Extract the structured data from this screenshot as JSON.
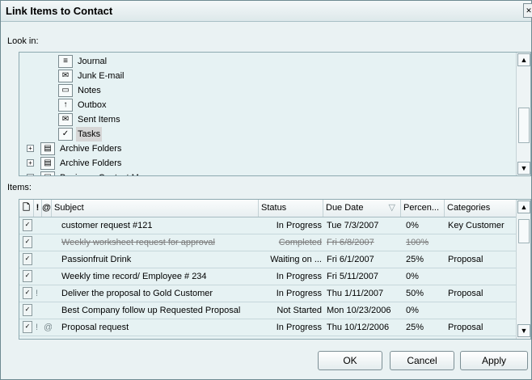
{
  "dialog": {
    "title": "Link Items to Contact"
  },
  "look_in_label": "Look in:",
  "items_label": "Items:",
  "folders": [
    {
      "label": "Journal",
      "icon": "journal-icon",
      "glyph": "≡"
    },
    {
      "label": "Junk E-mail",
      "icon": "junk-email-icon",
      "glyph": "✉"
    },
    {
      "label": "Notes",
      "icon": "notes-icon",
      "glyph": "▭"
    },
    {
      "label": "Outbox",
      "icon": "outbox-icon",
      "glyph": "↑"
    },
    {
      "label": "Sent Items",
      "icon": "sent-items-icon",
      "glyph": "✉"
    },
    {
      "label": "Tasks",
      "icon": "tasks-icon",
      "glyph": "✓",
      "selected": true
    },
    {
      "label": "Archive Folders",
      "icon": "archive-folder-icon",
      "glyph": "▤",
      "expander": "+"
    },
    {
      "label": "Archive Folders",
      "icon": "archive-folder-icon",
      "glyph": "▤",
      "expander": "+"
    },
    {
      "label": "Business Contact Manager",
      "icon": "folder-icon",
      "glyph": "▤",
      "expander": "+"
    }
  ],
  "columns": {
    "icon": "🗋",
    "importance": "!",
    "attachment": "@",
    "subject": "Subject",
    "status": "Status",
    "due_date": "Due Date",
    "percent": "Percen...",
    "categories": "Categories"
  },
  "rows": [
    {
      "importance": "",
      "attachment": "",
      "subject": "customer request #121",
      "status": "In Progress",
      "due": "Tue 7/3/2007",
      "percent": "0%",
      "categories": "Key Customer",
      "completed": false
    },
    {
      "importance": "",
      "attachment": "",
      "subject": "Weekly worksheet request for approval",
      "status": "Completed",
      "due": "Fri 6/8/2007",
      "percent": "100%",
      "categories": "",
      "completed": true
    },
    {
      "importance": "",
      "attachment": "",
      "subject": "Passionfruit Drink",
      "status": "Waiting on ...",
      "due": "Fri 6/1/2007",
      "percent": "25%",
      "categories": "Proposal",
      "completed": false
    },
    {
      "importance": "",
      "attachment": "",
      "subject": "Weekly time record/  Employee # 234",
      "status": "In Progress",
      "due": "Fri 5/11/2007",
      "percent": "0%",
      "categories": "",
      "completed": false
    },
    {
      "importance": "!",
      "attachment": "",
      "subject": "Deliver the proposal to Gold Customer",
      "status": "In Progress",
      "due": "Thu 1/11/2007",
      "percent": "50%",
      "categories": "Proposal",
      "completed": false
    },
    {
      "importance": "",
      "attachment": "",
      "subject": "Best Company follow up Requested Proposal",
      "status": "Not Started",
      "due": "Mon 10/23/2006",
      "percent": "0%",
      "categories": "",
      "completed": false
    },
    {
      "importance": "!",
      "attachment": "@",
      "subject": "Proposal request",
      "status": "In Progress",
      "due": "Thu 10/12/2006",
      "percent": "25%",
      "categories": "Proposal",
      "completed": false
    }
  ],
  "buttons": {
    "ok": "OK",
    "cancel": "Cancel",
    "apply": "Apply"
  },
  "glyphs": {
    "scroll_up": "▲",
    "scroll_down": "▼",
    "close": "✕",
    "sort_arrow": "▽"
  },
  "colors": {
    "accent": "#8da9b0",
    "background": "#e6f2f3",
    "selected": "#d6d6d6"
  }
}
